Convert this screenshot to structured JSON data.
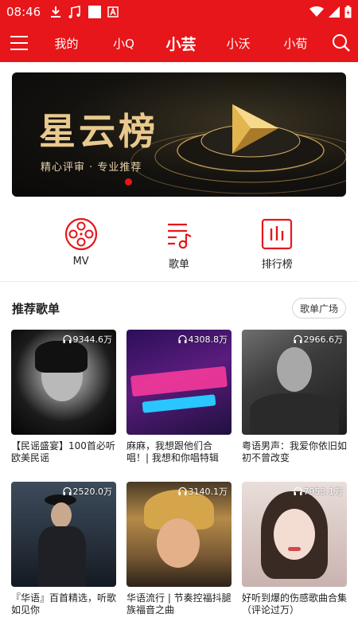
{
  "status_bar": {
    "time": "08:46",
    "icons": [
      "download-icon",
      "music-icon",
      "white-square-icon",
      "a-icon",
      "wifi-icon",
      "signal-icon",
      "battery-icon"
    ]
  },
  "nav": {
    "tabs": [
      {
        "label": "我的",
        "active": false
      },
      {
        "label": "小Q",
        "active": false
      },
      {
        "label": "小芸",
        "active": true
      },
      {
        "label": "小沃",
        "active": false
      },
      {
        "label": "小荀",
        "active": false
      }
    ]
  },
  "banner": {
    "title": "星云榜",
    "subtitle": "精心评审 · 专业推荐"
  },
  "quick": [
    {
      "label": "MV",
      "icon": "film-reel-icon"
    },
    {
      "label": "歌单",
      "icon": "playlist-icon"
    },
    {
      "label": "排行榜",
      "icon": "bar-chart-icon"
    }
  ],
  "section": {
    "title": "推荐歌单",
    "more_label": "歌单广场"
  },
  "playlists": [
    {
      "count": "9344.6万",
      "title": "【民谣盛宴】100首必听欧美民谣"
    },
    {
      "count": "4308.8万",
      "title": "麻麻，我想跟他们合唱！| 我想和你唱特辑"
    },
    {
      "count": "2966.6万",
      "title": "粤语男声：我爱你依旧如初不曾改变"
    },
    {
      "count": "2520.0万",
      "title": "『华语』百首精选，听歌如见你"
    },
    {
      "count": "3140.1万",
      "title": "华语流行 | 节奏控福抖腿族福音之曲"
    },
    {
      "count": "7953.1万",
      "title": "好听到爆的伤感歌曲合集（评论过万）"
    }
  ],
  "colors": {
    "brand_red": "#e7161a",
    "text": "#222222",
    "gold": "#e9c98d"
  }
}
